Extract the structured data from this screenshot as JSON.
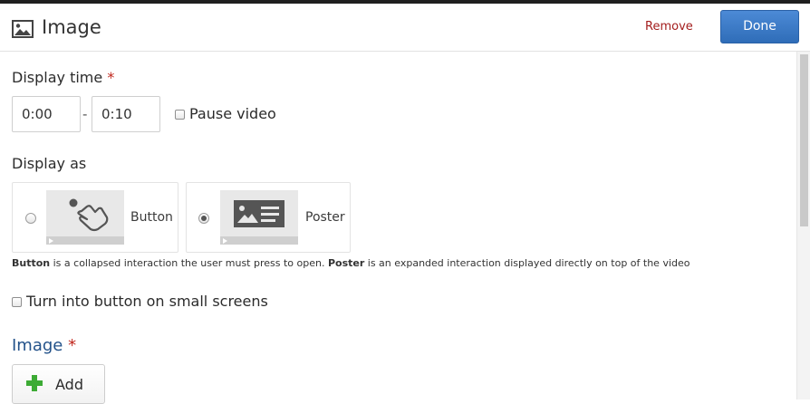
{
  "header": {
    "icon": "image-icon",
    "title": "Image",
    "remove_label": "Remove",
    "done_label": "Done"
  },
  "display_time": {
    "label": "Display time",
    "required_mark": "*",
    "start": "0:00",
    "end": "0:10",
    "separator": "-",
    "pause_video_label": "Pause video",
    "pause_video_checked": false
  },
  "display_as": {
    "label": "Display as",
    "options": [
      {
        "label": "Button",
        "icon": "tap-hand-icon",
        "selected": false
      },
      {
        "label": "Poster",
        "icon": "poster-icon",
        "selected": true
      }
    ],
    "description": {
      "button_term": "Button",
      "button_text": " is a collapsed interaction the user must press to open. ",
      "poster_term": "Poster",
      "poster_text": " is an expanded interaction displayed directly on top of the video"
    }
  },
  "small_screens": {
    "label": "Turn into button on small screens",
    "checked": false
  },
  "image_section": {
    "title": "Image",
    "required_mark": "*",
    "add_label": "Add",
    "add_icon": "plus-icon"
  },
  "colors": {
    "primary_button": "#3b7bc8",
    "remove_link": "#a31d1d",
    "required": "#c0271d",
    "section_title": "#23528a",
    "add_plus": "#3dab35"
  }
}
